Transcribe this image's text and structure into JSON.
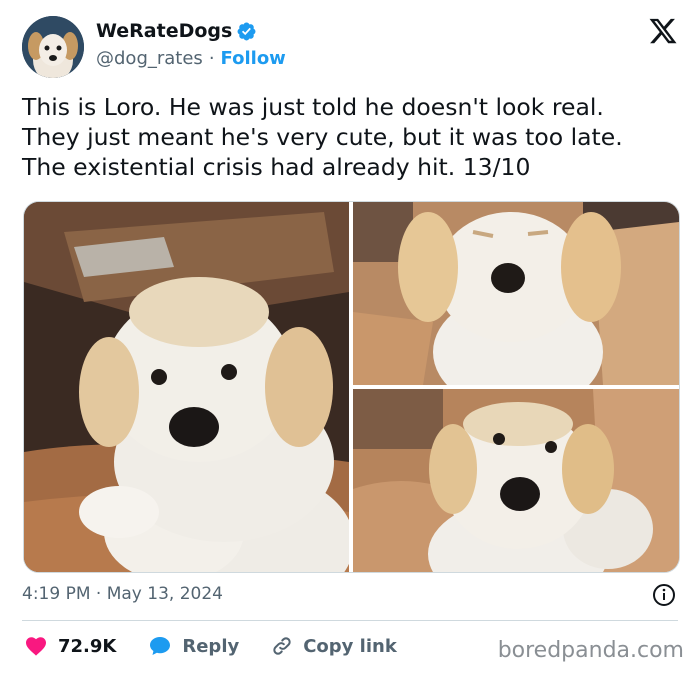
{
  "header": {
    "display_name": "WeRateDogs",
    "handle": "@dog_rates",
    "separator": "·",
    "follow_label": "Follow"
  },
  "tweet": {
    "lines": [
      "This is Loro. He was just told he doesn't look real.",
      "They just meant he's very cute, but it was too late.",
      "The existential crisis had already hit. 13/10"
    ]
  },
  "meta": {
    "timestamp": "4:19 PM · May 13, 2024"
  },
  "actions": {
    "likes": "72.9K",
    "reply_label": "Reply",
    "copy_label": "Copy link"
  },
  "watermark": "boredpanda.com",
  "colors": {
    "accent": "#1d9bf0",
    "like": "#f91880",
    "text": "#0f1419",
    "muted": "#536471"
  },
  "icons": [
    "verified-badge-icon",
    "x-logo-icon",
    "info-icon",
    "heart-icon",
    "reply-bubble-icon",
    "link-icon"
  ]
}
